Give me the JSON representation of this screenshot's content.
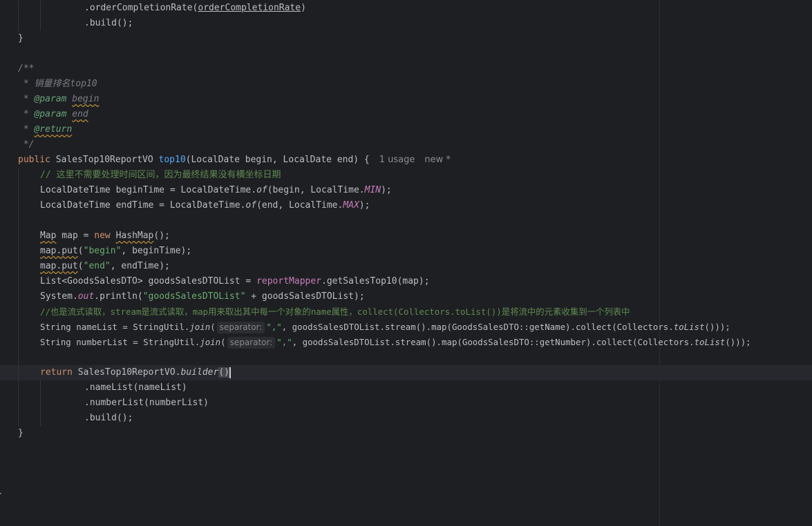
{
  "code": {
    "l01": ".orderCompletionRate(",
    "l01_arg": "orderCompletionRate",
    "l01_end": ")",
    "l02": ".build();",
    "l03": "}",
    "l05": "/**",
    "l06": " * 销量排名top10",
    "l07_star": " * ",
    "l07_tag": "@param",
    "l07_name": "begin",
    "l08_star": " * ",
    "l08_tag": "@param",
    "l08_name": "end",
    "l09_star": " * ",
    "l09_tag": "@return",
    "l10": " */",
    "l11_kw": "public",
    "l11_type": " SalesTop10ReportVO ",
    "l11_fn": "top10",
    "l11_params": "(LocalDate begin, LocalDate end) {",
    "l11_usage": "1 usage",
    "l11_new": "new *",
    "l12": "// 这里不需要处理时间区间，因为最终结果没有横坐标日期",
    "l13_a": "LocalDateTime beginTime = LocalDateTime.",
    "l13_of": "of",
    "l13_b": "(begin, LocalTime.",
    "l13_min": "MIN",
    "l13_c": ");",
    "l14_a": "LocalDateTime endTime = LocalDateTime.",
    "l14_of": "of",
    "l14_b": "(end, LocalTime.",
    "l14_max": "MAX",
    "l14_c": ");",
    "l16_map": "Map",
    "l16_a": " map = ",
    "l16_new": "new",
    "l16_sp": " ",
    "l16_hash": "HashMap",
    "l16_b": "();",
    "l17_put": "map.put",
    "l17_a": "(",
    "l17_str": "\"begin\"",
    "l17_b": ", beginTime);",
    "l18_put": "map.put",
    "l18_a": "(",
    "l18_str": "\"end\"",
    "l18_b": ", endTime);",
    "l19_a": "List<GoodsSalesDTO> goodsSalesDTOList = ",
    "l19_field": "reportMapper",
    "l19_b": ".getSalesTop10(map);",
    "l20_a": "System.",
    "l20_out": "out",
    "l20_b": ".println(",
    "l20_str": "\"goodsSalesDTOList\"",
    "l20_c": " + goodsSalesDTOList);",
    "l21": "//也是流式读取，stream是流式读取，map用来取出其中每一个对象的name属性，collect(Collectors.toList())是将流中的元素收集到一个列表中",
    "l22_a": "String nameList = StringUtil.",
    "l22_join": "join",
    "l22_b": "(",
    "l22_hint": "separator:",
    "l22_str": "\",\"",
    "l22_c": ", goodsSalesDTOList.stream().map(GoodsSalesDTO::getName).collect(Collectors.",
    "l22_tolist": "toList",
    "l22_d": "()));",
    "l23_a": "String numberList = StringUtil.",
    "l23_join": "join",
    "l23_b": "(",
    "l23_hint": "separator:",
    "l23_str": "\",\"",
    "l23_c": ", goodsSalesDTOList.stream().map(GoodsSalesDTO::getNumber).collect(Collectors.",
    "l23_tolist": "toList",
    "l23_d": "()));",
    "l25_kw": "return",
    "l25_a": " SalesTop10ReportVO.",
    "l25_builder": "builder",
    "l25_paren": "()",
    "l26": ".nameList(nameList)",
    "l27": ".numberList(numberList)",
    "l28": ".build();",
    "l29": "}"
  },
  "colors": {
    "background": "#1e1f22",
    "keyword": "#cf8e6d",
    "function": "#56a8f5",
    "string": "#6aab73",
    "comment": "#7a7e85",
    "field": "#c77dbb"
  }
}
